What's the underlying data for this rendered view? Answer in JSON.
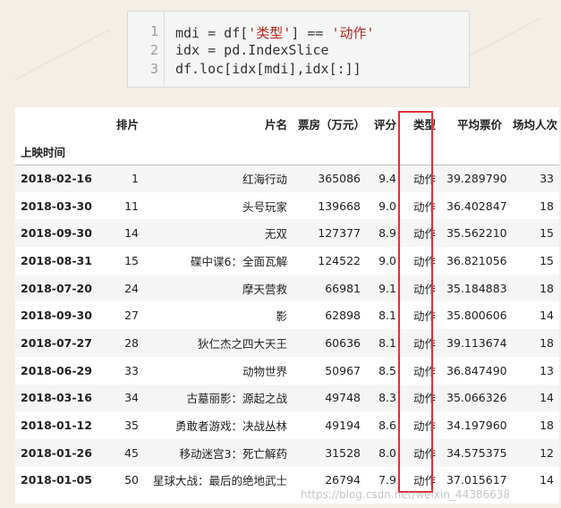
{
  "code": {
    "line_numbers": [
      "1",
      "2",
      "3"
    ],
    "line1_a": "mdi = df[",
    "line1_s1": "'类型'",
    "line1_b": "] == ",
    "line1_s2": "'动作'",
    "line2": "idx = pd.IndexSlice",
    "line3": "df.loc[idx[mdi],idx[:]]"
  },
  "table": {
    "columns": [
      "排片",
      "片名",
      "票房（万元）",
      "评分",
      "类型",
      "平均票价",
      "场均人次"
    ],
    "index_name": "上映时间",
    "rows": [
      [
        "2018-02-16",
        "1",
        "红海行动",
        "365086",
        "9.4",
        "动作",
        "39.289790",
        "33"
      ],
      [
        "2018-03-30",
        "11",
        "头号玩家",
        "139668",
        "9.0",
        "动作",
        "36.402847",
        "18"
      ],
      [
        "2018-09-30",
        "14",
        "无双",
        "127377",
        "8.9",
        "动作",
        "35.562210",
        "15"
      ],
      [
        "2018-08-31",
        "15",
        "碟中谍6：全面瓦解",
        "124522",
        "9.0",
        "动作",
        "36.821056",
        "15"
      ],
      [
        "2018-07-20",
        "24",
        "摩天营救",
        "66981",
        "9.1",
        "动作",
        "35.184883",
        "18"
      ],
      [
        "2018-09-30",
        "27",
        "影",
        "62898",
        "8.1",
        "动作",
        "35.800606",
        "14"
      ],
      [
        "2018-07-27",
        "28",
        "狄仁杰之四大天王",
        "60636",
        "8.1",
        "动作",
        "39.113674",
        "18"
      ],
      [
        "2018-06-29",
        "33",
        "动物世界",
        "50967",
        "8.5",
        "动作",
        "36.847490",
        "13"
      ],
      [
        "2018-03-16",
        "34",
        "古墓丽影：源起之战",
        "49748",
        "8.3",
        "动作",
        "35.066326",
        "14"
      ],
      [
        "2018-01-12",
        "35",
        "勇敢者游戏：决战丛林",
        "49194",
        "8.6",
        "动作",
        "34.197960",
        "18"
      ],
      [
        "2018-01-26",
        "45",
        "移动迷宫3：死亡解药",
        "31528",
        "8.0",
        "动作",
        "34.575375",
        "12"
      ],
      [
        "2018-01-05",
        "50",
        "星球大战：最后的绝地武士",
        "26794",
        "7.9",
        "动作",
        "37.015617",
        "14"
      ]
    ]
  },
  "watermark": "https://blog.csdn.net/weixin_44386638",
  "colors": {
    "highlight": "#e0313a",
    "string": "#b3261e"
  }
}
